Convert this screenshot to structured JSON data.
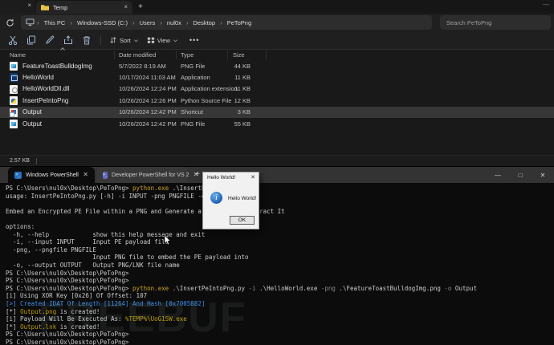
{
  "explorer": {
    "tabs": {
      "active_label": "Temp",
      "close_glyph": "×",
      "new_tab_glyph": "+"
    },
    "breadcrumb": [
      "This PC",
      "Windows-SSD (C:)",
      "Users",
      "nul0x",
      "Desktop",
      "PeToPng"
    ],
    "search_placeholder": "Search PeToPng",
    "toolbar": {
      "sort_label": "Sort",
      "view_label": "View",
      "more_glyph": "•••"
    },
    "columns": [
      "Name",
      "Date modified",
      "Type",
      "Size"
    ],
    "files": [
      {
        "name": "FeatureToastBulldogImg",
        "date": "5/7/2022 8:19 AM",
        "type": "PNG File",
        "size": "44 KB",
        "icon": "png-file-icon",
        "selected": false
      },
      {
        "name": "HelloWorld",
        "date": "10/17/2024 11:03 AM",
        "type": "Application",
        "size": "11 KB",
        "icon": "application-icon",
        "selected": false
      },
      {
        "name": "HelloWorldDll.dll",
        "date": "10/26/2024 12:24 PM",
        "type": "Application extension",
        "size": "11 KB",
        "icon": "dll-icon",
        "selected": false
      },
      {
        "name": "InsertPeIntoPng",
        "date": "10/26/2024 12:26 PM",
        "type": "Python Source File",
        "size": "12 KB",
        "icon": "python-file-icon",
        "selected": false
      },
      {
        "name": "Output",
        "date": "10/26/2024 12:42 PM",
        "type": "Shortcut",
        "size": "3 KB",
        "icon": "shortcut-icon",
        "selected": true
      },
      {
        "name": "Output",
        "date": "10/26/2024 12:42 PM",
        "type": "PNG File",
        "size": "55 KB",
        "icon": "png-file-icon",
        "selected": false
      }
    ],
    "status_size": "2.57 KB",
    "window_min_glyph": "—"
  },
  "terminal": {
    "tabs": [
      {
        "label": "Windows PowerShell",
        "active": true
      },
      {
        "label": "Developer PowerShell for VS 2",
        "active": false
      }
    ],
    "new_tab_glyph": "+",
    "window_controls": {
      "minimize": "—",
      "maximize": "□",
      "close": "✕"
    },
    "lines": [
      [
        {
          "t": "PS C:\\Users\\nul0x\\Desktop\\PeToPng> ",
          "c": "d"
        },
        {
          "t": "python.exe",
          "c": "c"
        },
        {
          "t": " .\\InsertPeIntoPng.py",
          "c": "d"
        }
      ],
      [
        {
          "t": "usage: InsertPeIntoPng.py [-h] -i INPUT -png PNGFILE -o OUTPUT",
          "c": "d"
        }
      ],
      [],
      [
        {
          "t": "Embed an Encrypted PE File within a PNG and Generate a LNK File To Extract It",
          "c": "d"
        }
      ],
      [],
      [
        {
          "t": "options:",
          "c": "d"
        }
      ],
      [
        {
          "t": "  -h, --help            show this help message and exit",
          "c": "d"
        }
      ],
      [
        {
          "t": "  -i, --input INPUT     Input PE payload file",
          "c": "d"
        }
      ],
      [
        {
          "t": "  -png, --pngfile PNGFILE",
          "c": "d"
        }
      ],
      [
        {
          "t": "                        Input PNG file to embed the PE payload into",
          "c": "d"
        }
      ],
      [
        {
          "t": "  -o, --output OUTPUT   Output PNG/LNK file name",
          "c": "d"
        }
      ],
      [
        {
          "t": "PS C:\\Users\\nul0x\\Desktop\\PeToPng>",
          "c": "d"
        }
      ],
      [
        {
          "t": "PS C:\\Users\\nul0x\\Desktop\\PeToPng>",
          "c": "d"
        }
      ],
      [
        {
          "t": "PS C:\\Users\\nul0x\\Desktop\\PeToPng> ",
          "c": "d"
        },
        {
          "t": "python.exe",
          "c": "c"
        },
        {
          "t": " .\\InsertPeIntoPng.py ",
          "c": "d"
        },
        {
          "t": "-i",
          "c": "p"
        },
        {
          "t": " .\\HelloWorld.exe ",
          "c": "d"
        },
        {
          "t": "-png",
          "c": "p"
        },
        {
          "t": " .\\FeatureToastBulldogImg.png ",
          "c": "d"
        },
        {
          "t": "-o",
          "c": "p"
        },
        {
          "t": " Output",
          "c": "d"
        }
      ],
      [
        {
          "t": "[i] Using XOR Key [0x26] Of Offset: 107",
          "c": "d"
        }
      ],
      [
        {
          "t": "[>] Created IDAT Of Length [11264] And Hash [0x7005882]",
          "c": "b"
        }
      ],
      [
        {
          "t": "[*] ",
          "c": "d"
        },
        {
          "t": "Output.png",
          "c": "y"
        },
        {
          "t": " is created!",
          "c": "d"
        }
      ],
      [
        {
          "t": "[i] Payload Will Be Executed As: ",
          "c": "d"
        },
        {
          "t": "%TEMP%\\UoG1SW.exe",
          "c": "y"
        }
      ],
      [
        {
          "t": "[*] ",
          "c": "d"
        },
        {
          "t": "Output.lnk",
          "c": "y"
        },
        {
          "t": " is created!",
          "c": "d"
        }
      ],
      [
        {
          "t": "PS C:\\Users\\nul0x\\Desktop\\PeToPng>",
          "c": "d"
        }
      ],
      [
        {
          "t": "PS C:\\Users\\nul0x\\Desktop\\PeToPng>",
          "c": "d"
        }
      ]
    ]
  },
  "dialog": {
    "title": "Hello World!",
    "message": "Hello World!",
    "ok_label": "OK",
    "close_glyph": "✕"
  },
  "watermark": "FREEBUF",
  "colors": {
    "terminal_bg": "#0c0c0c",
    "command_yellow": "#c9a227",
    "output_yellow": "#c19c00",
    "info_blue": "#3b8eea",
    "selection_gray": "#373737"
  }
}
